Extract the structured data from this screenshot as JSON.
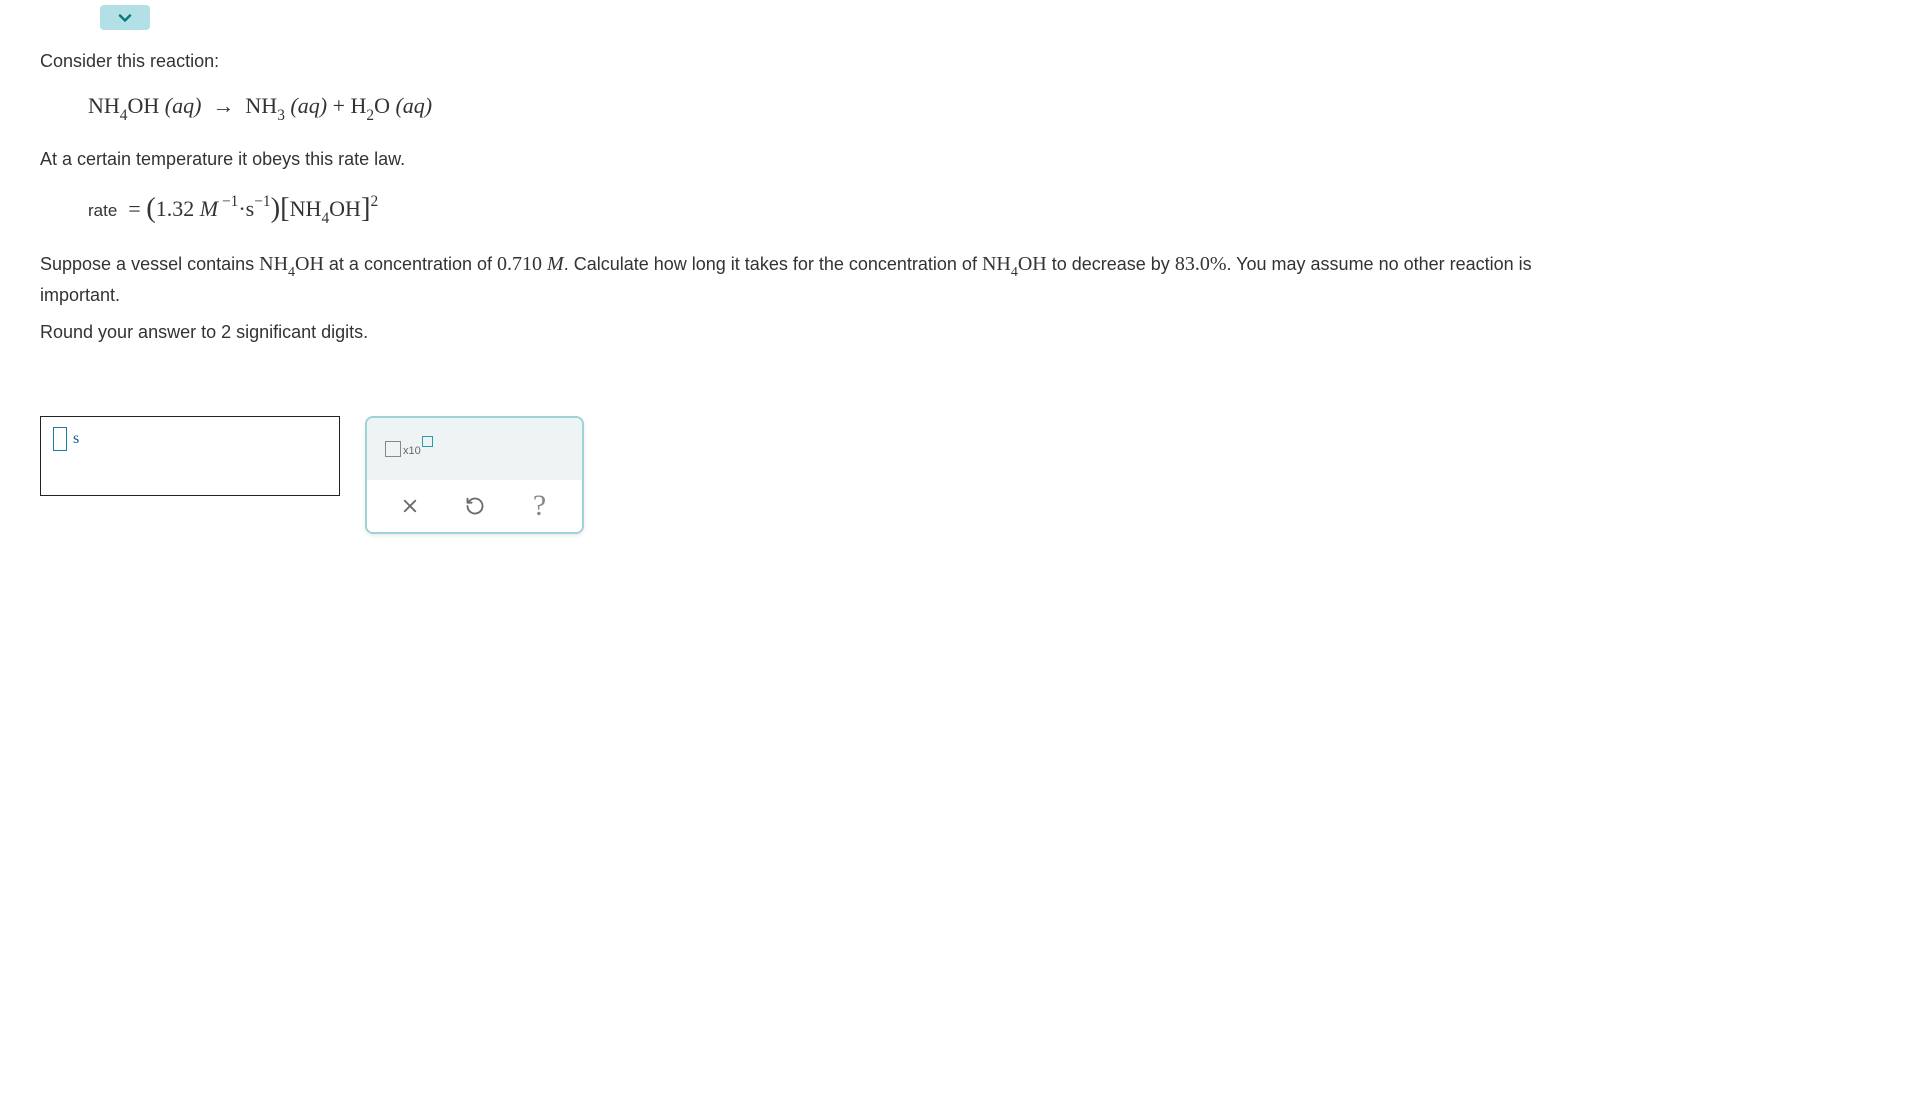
{
  "intro": "Consider this reaction:",
  "equation": {
    "lhs": "NH",
    "lhs_sub": "4",
    "lhs2": "OH",
    "lhs_state": "(aq)",
    "arrow": "→",
    "rhs1": "NH",
    "rhs1_sub": "3",
    "rhs1_state": "(aq)",
    "plus": "+",
    "rhs2": "H",
    "rhs2_sub": "2",
    "rhs3": "O",
    "rhs3_state": "(aq)"
  },
  "rate_law_intro": "At a certain temperature it obeys this rate law.",
  "rate": {
    "label": "rate",
    "eq": "=",
    "k_value": "1.32",
    "k_unit1": "M",
    "k_exp1": "−1",
    "k_dot": "·",
    "k_unit2": "s",
    "k_exp2": "−1",
    "species": "NH",
    "species_sub": "4",
    "species2": "OH",
    "order": "2"
  },
  "question": {
    "p1a": "Suppose a vessel contains ",
    "species": "NH",
    "species_sub": "4",
    "species2": "OH",
    "p1b": " at a concentration of ",
    "conc": "0.710",
    "conc_unit": "M",
    "p1c": ". Calculate how long it takes for the concentration of ",
    "p1d": " to decrease by ",
    "percent": "83.0%",
    "p1e": ". You may assume no other reaction is important."
  },
  "round_instr": "Round your answer to 2 significant digits.",
  "answer_unit": "s",
  "tool": {
    "sci_label": "x10"
  }
}
